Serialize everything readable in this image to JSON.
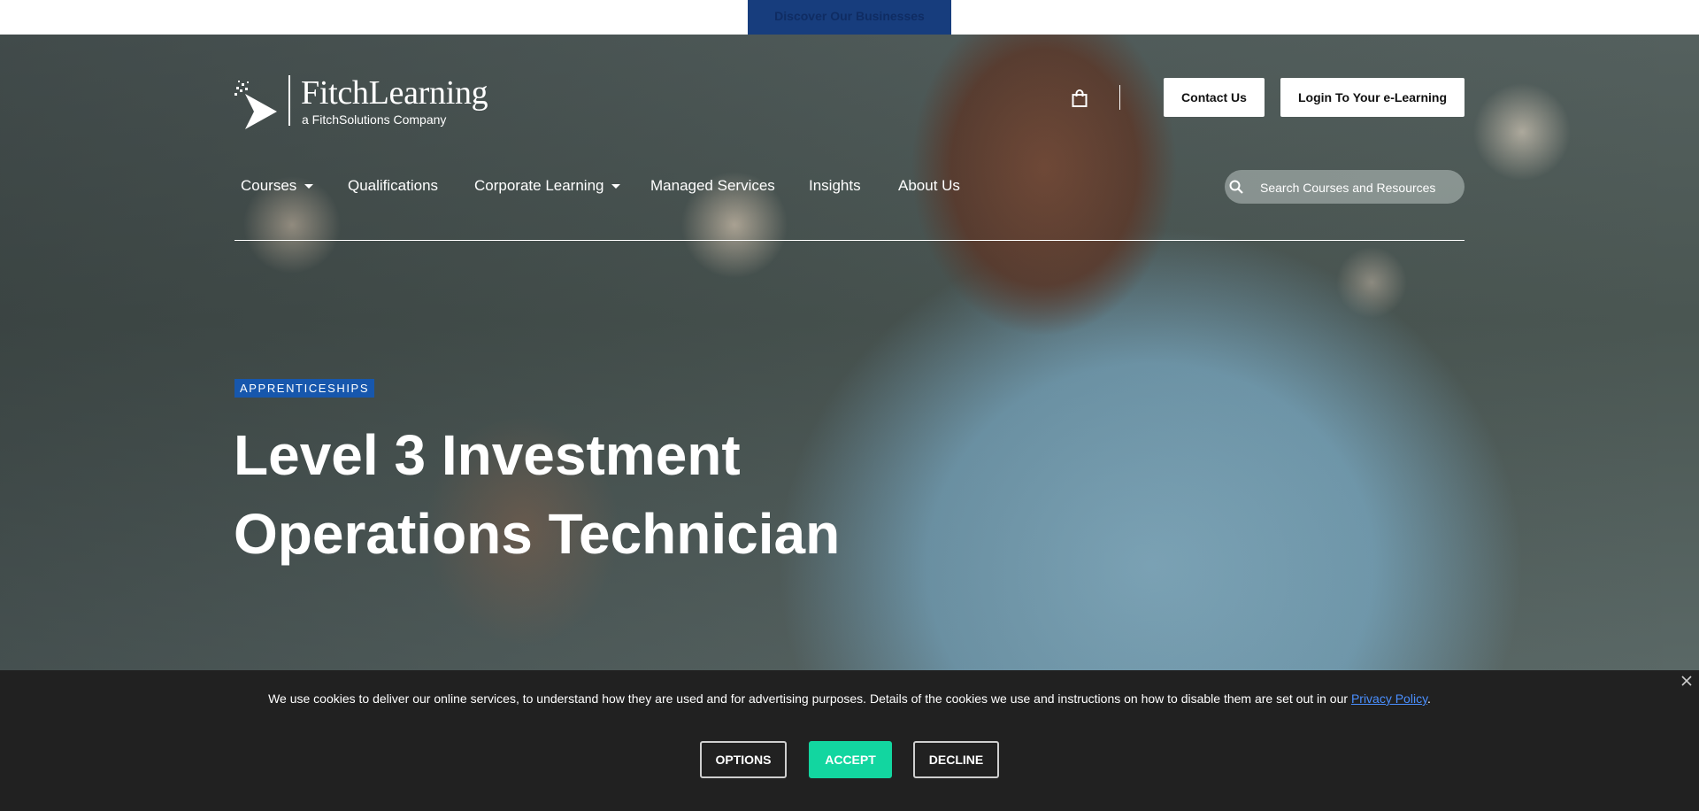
{
  "topbar": {
    "discover_label": "Discover Our Businesses"
  },
  "brand": {
    "name": "FitchLearning",
    "tagline": "a FitchSolutions Company"
  },
  "header": {
    "contact_label": "Contact Us",
    "login_label": "Login To Your e-Learning",
    "cart_icon": "shopping-bag-icon"
  },
  "nav": {
    "items": [
      {
        "label": "Courses",
        "has_dropdown": true
      },
      {
        "label": "Qualifications",
        "has_dropdown": false
      },
      {
        "label": "Corporate Learning",
        "has_dropdown": true
      },
      {
        "label": "Managed Services",
        "has_dropdown": false
      },
      {
        "label": "Insights",
        "has_dropdown": false
      },
      {
        "label": "About Us",
        "has_dropdown": false
      }
    ]
  },
  "search": {
    "placeholder": "Search Courses and Resources",
    "value": ""
  },
  "hero": {
    "badge": "APPRENTICESHIPS",
    "title_line1": "Level 3 Investment",
    "title_line2": "Operations Technician"
  },
  "cookie": {
    "text": "We use cookies to deliver our online services, to understand how they are used and for advertising purposes. Details of the cookies we use and instructions on how to disable them are set out in our ",
    "link_label": "Privacy Policy",
    "text_end": ".",
    "options_label": "OPTIONS",
    "accept_label": "ACCEPT",
    "decline_label": "DECLINE"
  },
  "colors": {
    "accept": "#12d6a0",
    "badge": "#1757ad",
    "cookie_bg": "#212121",
    "link": "#4a8fff"
  }
}
